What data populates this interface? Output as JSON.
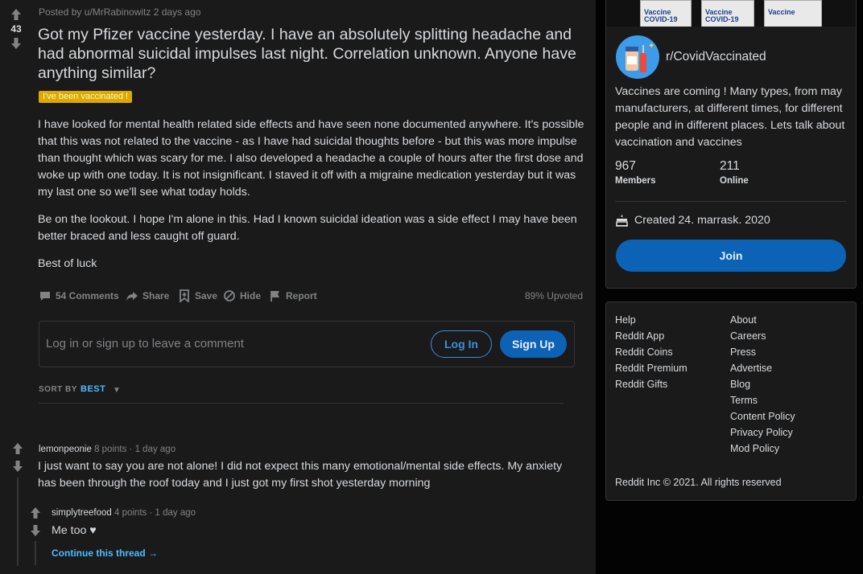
{
  "post": {
    "score": "43",
    "meta": "Posted by u/MrRabinowitz 2 days ago",
    "title": "Got my Pfizer vaccine yesterday. I have an absolutely splitting headache and had abnormal suicidal impulses last night. Correlation unknown. Anyone have anything similar?",
    "flair": "I've been vaccinated !",
    "body": [
      "I have looked for mental health related side effects and have seen none documented anywhere. It's possible that this was not related to the vaccine - as I have had suicidal thoughts before - but this was more impulse than thought which was scary for me. I also developed a headache a couple of hours after the first dose and woke up with one today. It is not insignificant. I staved it off with a migraine medication yesterday but it was my last one so we'll see what today holds.",
      "Be on the lookout. I hope I'm alone in this. Had I known suicidal ideation was a side effect I may have been better braced and less caught off guard.",
      "Best of luck"
    ],
    "actions": {
      "comments": "54 Comments",
      "share": "Share",
      "save": "Save",
      "hide": "Hide",
      "report": "Report",
      "upvoted": "89% Upvoted"
    }
  },
  "comment_box": {
    "placeholder": "Log in or sign up to leave a comment",
    "login": "Log In",
    "signup": "Sign Up"
  },
  "sort": {
    "label": "SORT BY",
    "value": "BEST"
  },
  "comments": [
    {
      "user": "lemonpeonie",
      "points": "8 points",
      "time": "1 day ago",
      "text": "I just want to say you are not alone! I did not expect this many emotional/mental side effects. My anxiety has been through the roof today and I just got my first shot yesterday morning"
    },
    {
      "user": "simplytreefood",
      "points": "4 points",
      "time": "1 day ago",
      "text": "Me too ♥"
    }
  ],
  "continue_thread": "Continue this thread",
  "sidebar": {
    "banner_vials": [
      "Vaccine\nCOVID-19",
      "Vaccine\nCOVID-19",
      "Vaccine"
    ],
    "subreddit": "r/CovidVaccinated",
    "description": "Vaccines are coming ! Many types, from may manufacturers, at different times, for different people and in different places. Lets talk about vaccination and vaccines",
    "members_count": "967",
    "members_label": "Members",
    "online_count": "211",
    "online_label": "Online",
    "created": "Created 24. marrask. 2020",
    "join": "Join"
  },
  "footer": {
    "left": [
      "Help",
      "Reddit App",
      "Reddit Coins",
      "Reddit Premium",
      "Reddit Gifts"
    ],
    "right": [
      "About",
      "Careers",
      "Press",
      "Advertise",
      "Blog",
      "Terms",
      "Content Policy",
      "Privacy Policy",
      "Mod Policy"
    ],
    "copyright": "Reddit Inc © 2021. All rights reserved"
  },
  "colors": {
    "accent": "#4fbcff",
    "join_button": "#0c62b5",
    "flair": "#dba900",
    "background": "#1a1a1b"
  }
}
